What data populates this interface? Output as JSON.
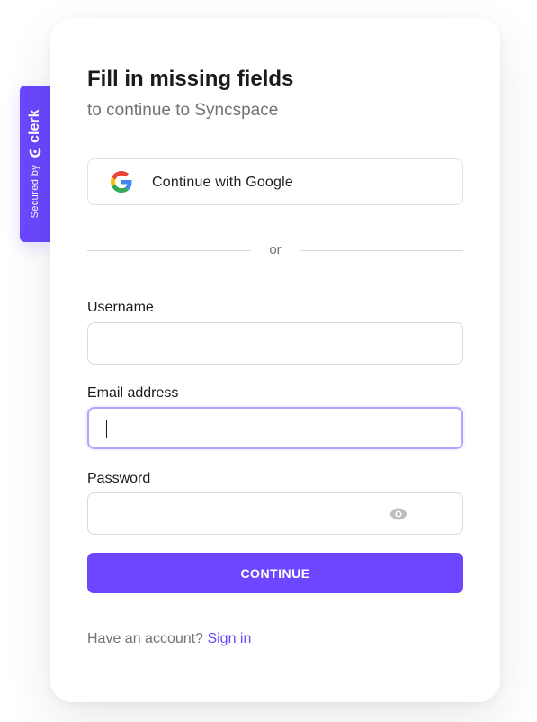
{
  "badge": {
    "secured_by": "Secured by",
    "brand": "clerk"
  },
  "header": {
    "title": "Fill in missing fields",
    "subtitle": "to continue to Syncspace"
  },
  "social": {
    "google_label": "Continue with Google",
    "google_icon": "google-icon"
  },
  "divider": {
    "text": "or"
  },
  "form": {
    "username": {
      "label": "Username",
      "value": ""
    },
    "email": {
      "label": "Email address",
      "value": ""
    },
    "password": {
      "label": "Password",
      "value": "",
      "toggle_icon": "eye-icon"
    },
    "submit_label": "CONTINUE"
  },
  "footer": {
    "prompt": "Have an account?",
    "link": "Sign in"
  },
  "colors": {
    "accent": "#6c47ff",
    "focus_border": "#b4a4ff",
    "muted_text": "#737373",
    "border": "#d9d9d9"
  }
}
